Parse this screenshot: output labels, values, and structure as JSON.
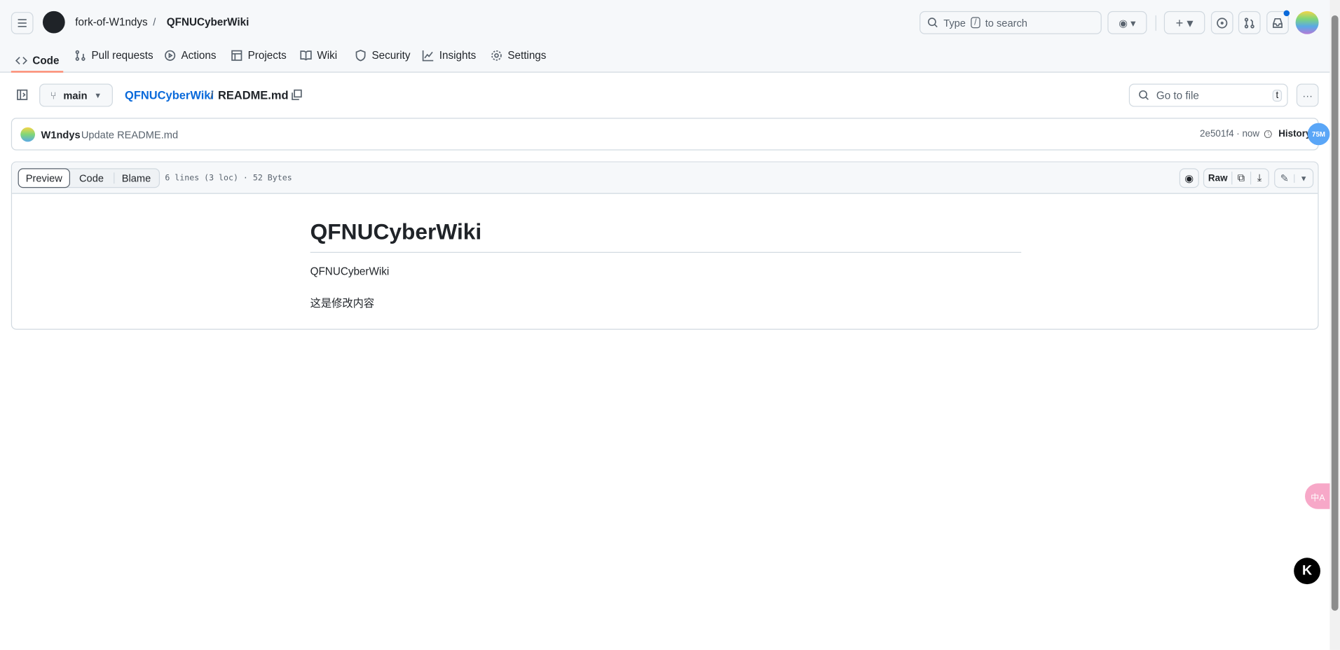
{
  "header": {
    "owner": "fork-of-W1ndys",
    "repo": "QFNUCyberWiki",
    "search_prefix": "Type",
    "search_key": "/",
    "search_suffix": "to search"
  },
  "tabs": [
    {
      "label": "Code"
    },
    {
      "label": "Pull requests"
    },
    {
      "label": "Actions"
    },
    {
      "label": "Projects"
    },
    {
      "label": "Wiki"
    },
    {
      "label": "Security"
    },
    {
      "label": "Insights"
    },
    {
      "label": "Settings"
    }
  ],
  "file_nav": {
    "branch": "main",
    "repo_link": "QFNUCyberWiki",
    "sep": "/",
    "file": "README.md",
    "goto_placeholder": "Go to file",
    "goto_key": "t"
  },
  "commit": {
    "author": "W1ndys",
    "message": "Update README.md",
    "sha": "2e501f4 · now",
    "history": "History",
    "badge": "75M"
  },
  "file_toolbar": {
    "modes": [
      "Preview",
      "Code",
      "Blame"
    ],
    "info": "6 lines (3 loc) · 52 Bytes",
    "raw": "Raw"
  },
  "readme": {
    "title": "QFNUCyberWiki",
    "p1": "QFNUCyberWiki",
    "p2": "这是修改内容"
  },
  "floating": {
    "translate": "中A",
    "k": "K"
  },
  "colors": {
    "accent": "#0969da",
    "tab_underline": "#fd8c73"
  }
}
